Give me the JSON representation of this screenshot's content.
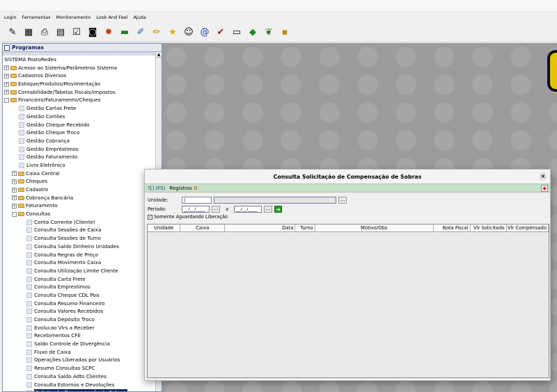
{
  "menu": [
    "Login",
    "Ferramentas",
    "Monitoramento",
    "Look And Feel",
    "Ajuda"
  ],
  "toolbar_icons": [
    "pencil-user-icon",
    "calculator-icon",
    "printer-icon",
    "cash-register-icon",
    "document-check-icon",
    "camera-icon",
    "gear-coin-icon",
    "money-icon",
    "notebook-icon",
    "pencil-icon",
    "star-icon",
    "face-icon",
    "at-sign-icon",
    "checkmark-icon",
    "card-icon",
    "brazil-flag-icon",
    "money-wings-icon",
    "folder-plus-icon"
  ],
  "sidebar": {
    "title": "Programas",
    "items": [
      {
        "label": "SISTEMA PostoRedes",
        "level": 0,
        "type": "root"
      },
      {
        "label": "Acesso ao Sistema/Parâmetros Sistema",
        "level": 0,
        "type": "folder",
        "state": "+"
      },
      {
        "label": "Cadastros Diversos",
        "level": 0,
        "type": "folder",
        "state": "+"
      },
      {
        "label": "Estoque/Produtos/Movimentação",
        "level": 0,
        "type": "folder",
        "state": "+"
      },
      {
        "label": "Contabilidade/Tabelas Fiscais/Impostos",
        "level": 0,
        "type": "folder",
        "state": "+"
      },
      {
        "label": "Financeiro/Faturamento/Cheques",
        "level": 0,
        "type": "folder",
        "state": "-"
      },
      {
        "label": "Gestão Cartas Frete",
        "level": 1,
        "type": "leaf"
      },
      {
        "label": "Gestão Cartões",
        "level": 1,
        "type": "leaf"
      },
      {
        "label": "Gestão Cheque Recebido",
        "level": 1,
        "type": "leaf"
      },
      {
        "label": "Gestão Cheque Troco",
        "level": 1,
        "type": "leaf"
      },
      {
        "label": "Gestão Cobrança",
        "level": 1,
        "type": "leaf"
      },
      {
        "label": "Gestão Empréstimos",
        "level": 1,
        "type": "leaf"
      },
      {
        "label": "Gestão Faturamento",
        "level": 1,
        "type": "leaf"
      },
      {
        "label": "Livro Eletrônico",
        "level": 1,
        "type": "leaf"
      },
      {
        "label": "Caixa Central",
        "level": 1,
        "type": "folder",
        "state": "+"
      },
      {
        "label": "Cheques",
        "level": 1,
        "type": "folder",
        "state": "+"
      },
      {
        "label": "Cadastro",
        "level": 1,
        "type": "folder",
        "state": "+"
      },
      {
        "label": "Cobrança Bancária",
        "level": 1,
        "type": "folder",
        "state": "+"
      },
      {
        "label": "Faturamento",
        "level": 1,
        "type": "folder",
        "state": "+"
      },
      {
        "label": "Consultas",
        "level": 1,
        "type": "folder",
        "state": "-"
      },
      {
        "label": "Conta Corrente (Cliente)",
        "level": 2,
        "type": "leaf"
      },
      {
        "label": "Consulta Sessões de Caixa",
        "level": 2,
        "type": "leaf"
      },
      {
        "label": "Consulta Sessões de Turno",
        "level": 2,
        "type": "leaf"
      },
      {
        "label": "Consulta Saldo Dinheiro Unidades",
        "level": 2,
        "type": "leaf"
      },
      {
        "label": "Consulta Regras de Preço",
        "level": 2,
        "type": "leaf"
      },
      {
        "label": "Consulta Movimento Caixa",
        "level": 2,
        "type": "leaf"
      },
      {
        "label": "Consulta Utilização Limite Cliente",
        "level": 2,
        "type": "leaf"
      },
      {
        "label": "Consulta Carta Frete",
        "level": 2,
        "type": "leaf"
      },
      {
        "label": "Consulta Emprestimos",
        "level": 2,
        "type": "leaf"
      },
      {
        "label": "Consulta Cheque CDL Poa",
        "level": 2,
        "type": "leaf"
      },
      {
        "label": "Consulta Resumo Financeiro",
        "level": 2,
        "type": "leaf"
      },
      {
        "label": "Consulta Valores Recebidos",
        "level": 2,
        "type": "leaf"
      },
      {
        "label": "Consulta Depósito Troco",
        "level": 2,
        "type": "leaf"
      },
      {
        "label": "Evolucao Vlrs a Receber",
        "level": 2,
        "type": "leaf"
      },
      {
        "label": "Recebimentos CFE",
        "level": 2,
        "type": "leaf"
      },
      {
        "label": "Saldo Controle de Divergência",
        "level": 2,
        "type": "leaf"
      },
      {
        "label": "Fluxo de Caixa",
        "level": 2,
        "type": "leaf"
      },
      {
        "label": "Operações Liberadas por Usuários",
        "level": 2,
        "type": "leaf"
      },
      {
        "label": "Resumo Consultas SCPC",
        "level": 2,
        "type": "leaf"
      },
      {
        "label": "Consulta Saldo Adto Clientes",
        "level": 2,
        "type": "leaf"
      },
      {
        "label": "Consulta Estornos e Devoluções",
        "level": 2,
        "type": "leaf"
      },
      {
        "label": "Solicitação Compensação de Sobras",
        "level": 2,
        "type": "leaf",
        "selected": true
      }
    ]
  },
  "dialog": {
    "title": "Consulta Solicitação de Compensação de Sobras",
    "help_label": "?[] (F5)",
    "records_label": "Registros",
    "records_count": "0",
    "unidade_label": "Unidade:",
    "unidade_value": "|",
    "periodo_label": "Período:",
    "date_from": "__/__/____",
    "date_sep": "a",
    "date_to": "__/__/____",
    "checkbox_label": "Somente Aguardando Liberação",
    "checkbox_checked": true,
    "columns": [
      "Unidade",
      "Caixa",
      "Data",
      "Turno",
      "Motivo/Obs",
      "Nota Fiscal",
      "Vlr Solicitado",
      "Vlr Compensado"
    ]
  }
}
